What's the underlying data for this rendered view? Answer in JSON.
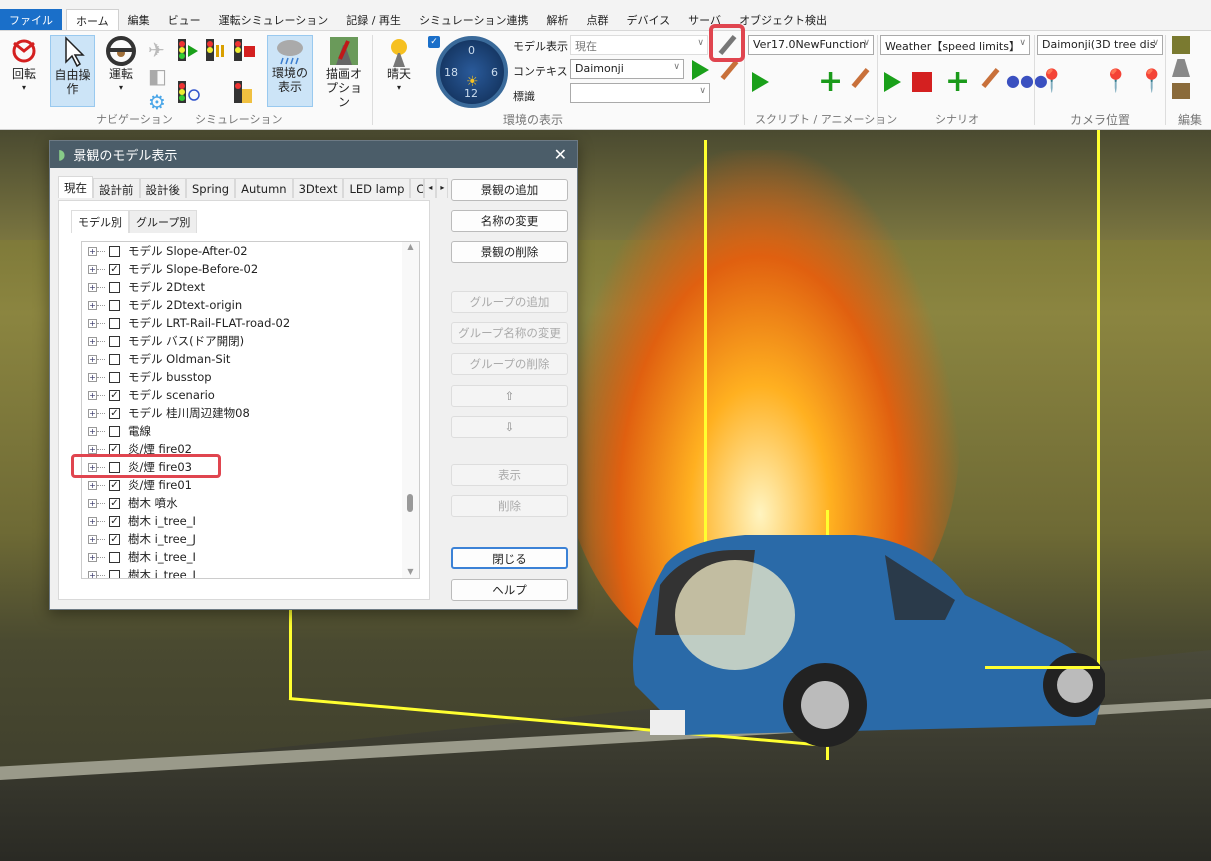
{
  "menu_tabs": [
    "ファイル",
    "ホーム",
    "編集",
    "ビュー",
    "運転シミュレーション",
    "記録 / 再生",
    "シミュレーション連携",
    "解析",
    "点群",
    "デバイス",
    "サーバ",
    "オブジェクト検出"
  ],
  "ribbon": {
    "rotate": "回転",
    "free_op": "自由操作",
    "drive": "運転",
    "env_display": "環境の表示",
    "draw_options": "描画オプション",
    "weather": "晴天",
    "groups": {
      "navigation": "ナビゲーション",
      "simulation": "シミュレーション",
      "environment": "環境の表示",
      "script": "スクリプト / アニメーション",
      "scenario": "シナリオ",
      "camera": "カメラ位置",
      "edit": "編集"
    },
    "model_display_label": "モデル表示",
    "model_display_value": "現在",
    "context_label": "コンテキスト",
    "context_value": "Daimonji",
    "sign_label": "標識",
    "sign_value": "",
    "script_value": "Ver17.0NewFunction",
    "scenario_value": "Weather【speed limits】",
    "camera_value": "Daimonji(3D tree dis",
    "clock": {
      "n12": "0",
      "n3": "6",
      "n6": "12",
      "n9": "18"
    }
  },
  "dialog": {
    "title": "景観のモデル表示",
    "tabs": [
      "現在",
      "設計前",
      "設計後",
      "Spring",
      "Autumn",
      "3Dtext",
      "LED lamp",
      "C"
    ],
    "subtabs": [
      "モデル別",
      "グループ別"
    ],
    "items": [
      {
        "label": "モデル Slope-After-02",
        "checked": false
      },
      {
        "label": "モデル Slope-Before-02",
        "checked": true
      },
      {
        "label": "モデル 2Dtext",
        "checked": false
      },
      {
        "label": "モデル 2Dtext-origin",
        "checked": false
      },
      {
        "label": "モデル LRT-Rail-FLAT-road-02",
        "checked": false
      },
      {
        "label": "モデル バス(ドア開閉)",
        "checked": false
      },
      {
        "label": "モデル Oldman-Sit",
        "checked": false
      },
      {
        "label": "モデル busstop",
        "checked": false
      },
      {
        "label": "モデル scenario",
        "checked": true
      },
      {
        "label": "モデル 桂川周辺建物08",
        "checked": true
      },
      {
        "label": "電線",
        "checked": false
      },
      {
        "label": "炎/煙 fire02",
        "checked": true
      },
      {
        "label": "炎/煙 fire03",
        "checked": false
      },
      {
        "label": "炎/煙 fire01",
        "checked": true
      },
      {
        "label": "樹木 噴水",
        "checked": true
      },
      {
        "label": "樹木 i_tree_I",
        "checked": true
      },
      {
        "label": "樹木 i_tree_J",
        "checked": true
      },
      {
        "label": "樹木 i_tree_I",
        "checked": false
      },
      {
        "label": "樹木 i_tree_J",
        "checked": false
      }
    ],
    "buttons": {
      "add": "景観の追加",
      "rename": "名称の変更",
      "delete_scene": "景観の削除",
      "add_group": "グループの追加",
      "rename_group": "グループ名称の変更",
      "delete_group": "グループの削除",
      "up": "⇧",
      "down": "⇩",
      "show": "表示",
      "delete": "削除",
      "close": "閉じる",
      "help": "ヘルプ"
    }
  },
  "colors": {
    "accent": "#1a6fc9",
    "highlight": "#e0454f",
    "bbox": "#ffff30"
  }
}
